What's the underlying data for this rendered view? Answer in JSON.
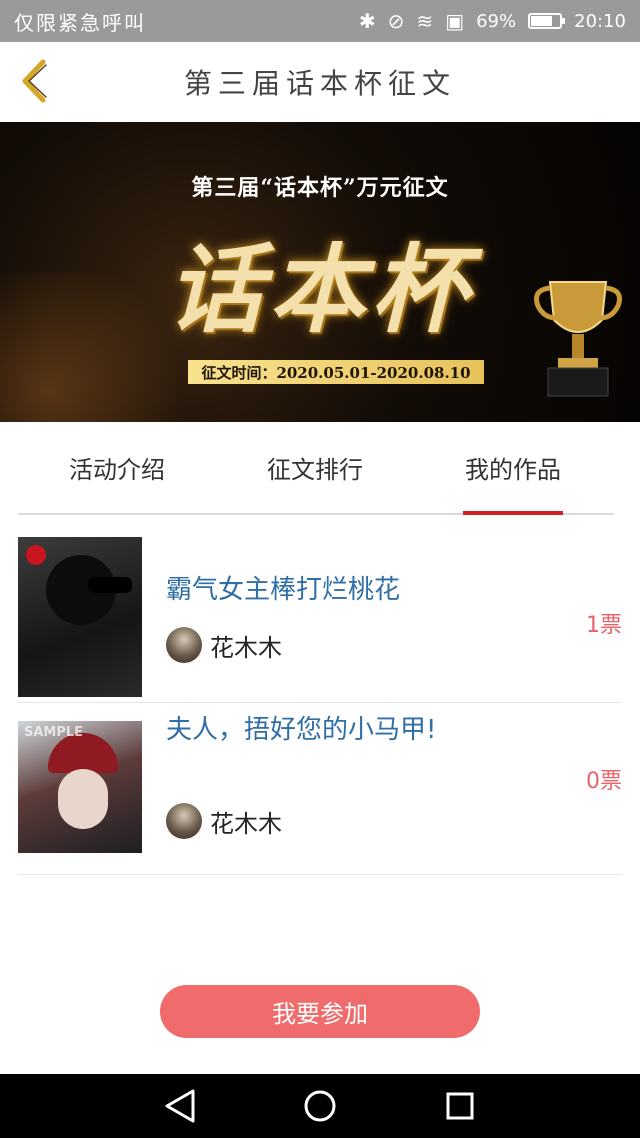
{
  "status_bar": {
    "carrier": "仅限紧急呼叫",
    "battery": "69%",
    "battery_level": 0.69,
    "time": "20:10",
    "icons": [
      "bluetooth-icon",
      "mute-icon",
      "wifi-icon",
      "sim-icon",
      "battery-icon"
    ]
  },
  "header": {
    "title": "第三届话本杯征文",
    "back_icon": "chevron-left-icon"
  },
  "banner": {
    "subtitle": "第三届“话本杯”万元征文",
    "main": "话本杯",
    "date": "征文时间：2020.05.01-2020.08.10"
  },
  "tabs": [
    {
      "label": "活动介绍",
      "active": false
    },
    {
      "label": "征文排行",
      "active": false
    },
    {
      "label": "我的作品",
      "active": true
    }
  ],
  "works": [
    {
      "title": "霸气女主棒打烂桃花",
      "author": "花木木",
      "votes": "1票"
    },
    {
      "title": "夫人，捂好您的小马甲!",
      "author": "花木木",
      "votes": "0票",
      "cover_watermark": "SAMPLE"
    }
  ],
  "join_button": "我要参加",
  "colors": {
    "accent": "#f06b6b",
    "tab_indicator": "#d42020",
    "title_blue": "#2f6fa5",
    "votes_red": "#e8636b",
    "back_icon": "#d4a62a"
  }
}
